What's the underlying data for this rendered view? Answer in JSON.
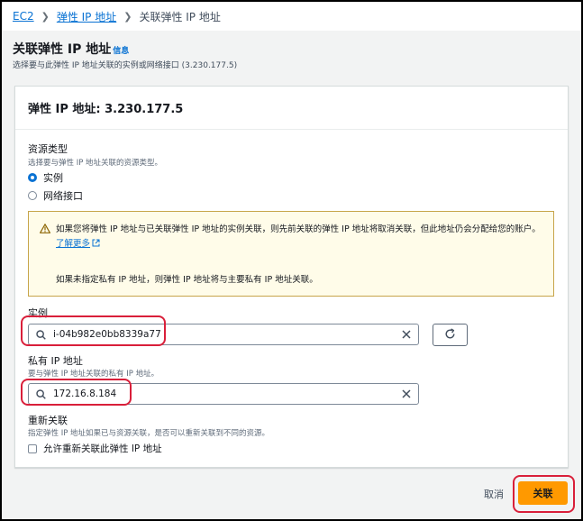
{
  "breadcrumb": {
    "items": [
      "EC2",
      "弹性 IP 地址"
    ],
    "current": "关联弹性 IP 地址"
  },
  "page": {
    "title": "关联弹性 IP 地址",
    "info_link": "信息",
    "description": "选择要与此弹性 IP 地址关联的实例或网络接口 (3.230.177.5)"
  },
  "card": {
    "header": "弹性 IP 地址: 3.230.177.5"
  },
  "resource_type": {
    "label": "资源类型",
    "description": "选择要与弹性 IP 地址关联的资源类型。",
    "options": [
      "实例",
      "网络接口"
    ],
    "selected_index": 0
  },
  "alert": {
    "text_part1": "如果您将弹性 IP 地址与已关联弹性 IP 地址的实例关联，则先前关联的弹性 IP 地址将取消关联，但此地址仍会分配给您的账户。",
    "link": "了解更多",
    "text_part2": "如果未指定私有 IP 地址，则弹性 IP 地址将与主要私有 IP 地址关联。"
  },
  "instance": {
    "label": "实例",
    "value": "i-04b982e0bb8339a77"
  },
  "private_ip": {
    "label": "私有 IP 地址",
    "description": "要与弹性 IP 地址关联的私有 IP 地址。",
    "value": "172.16.8.184"
  },
  "reassociation": {
    "label": "重新关联",
    "description": "指定弹性 IP 地址如果已与资源关联，是否可以重新关联到不同的资源。",
    "checkbox_label": "允许重新关联此弹性 IP 地址",
    "checked": false
  },
  "footer": {
    "cancel_label": "取消",
    "submit_label": "关联"
  },
  "colors": {
    "link": "#0972d3",
    "primary": "#ff9900",
    "highlight": "#d91f3a",
    "warning_bg": "#fffce9"
  }
}
